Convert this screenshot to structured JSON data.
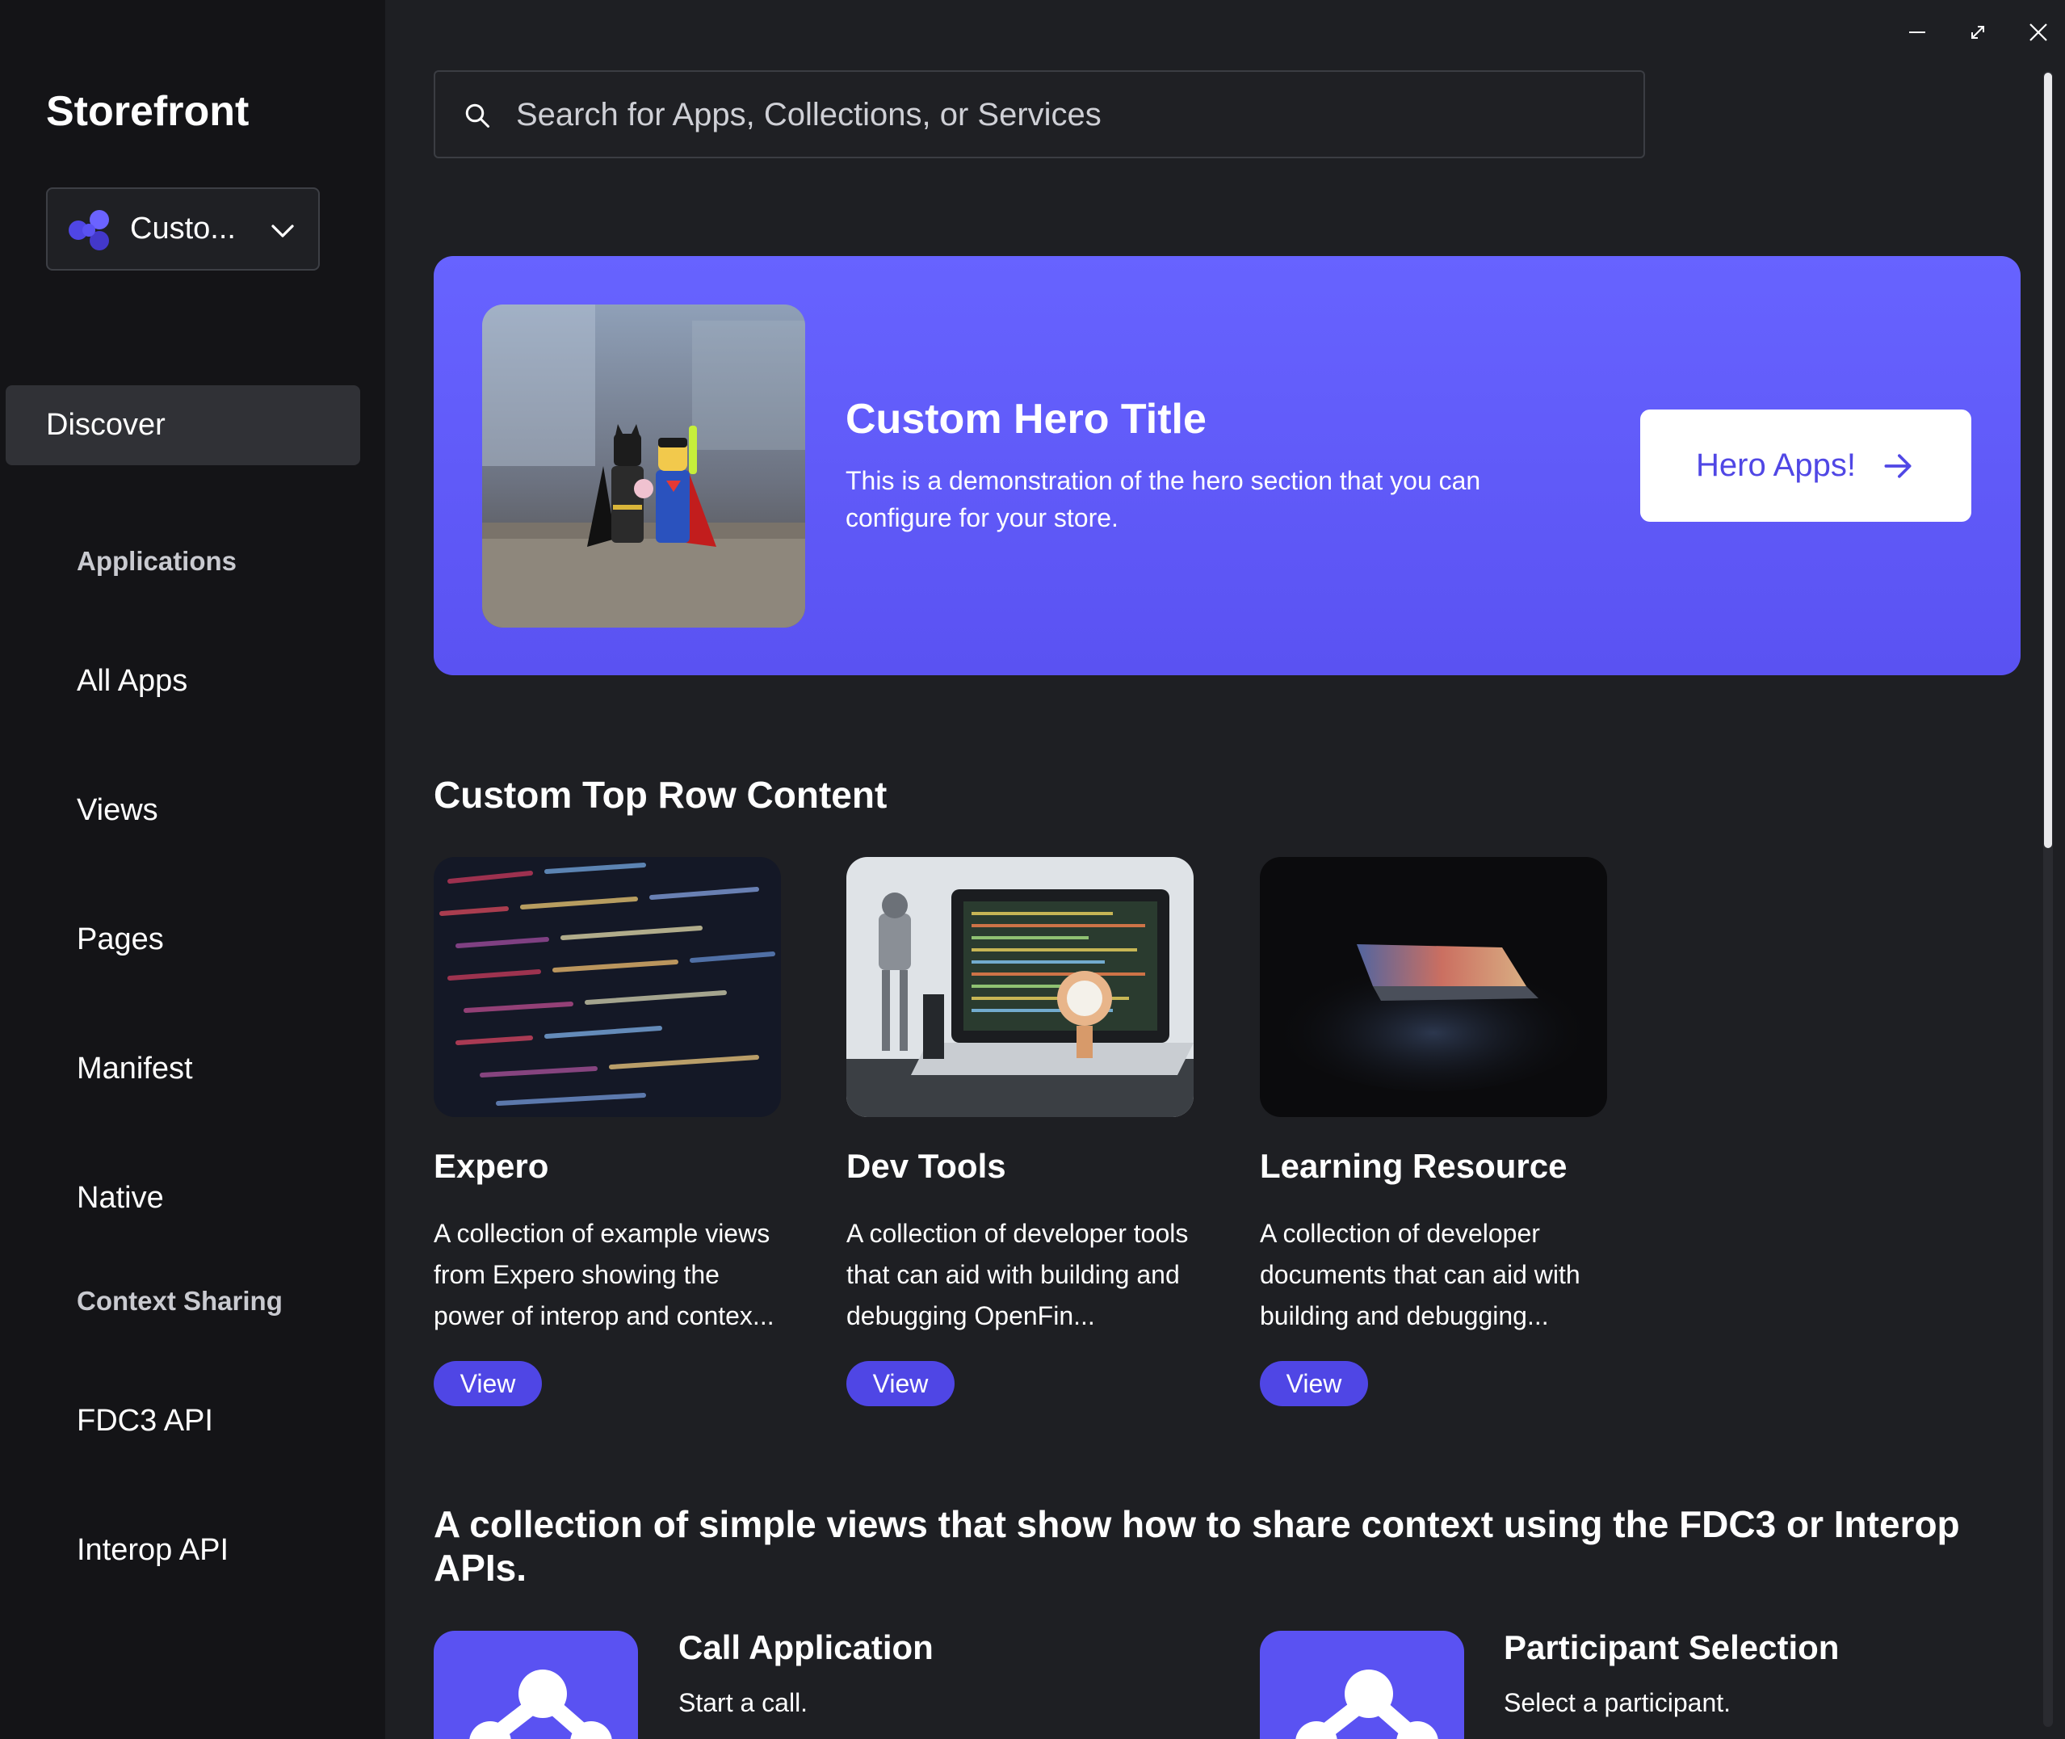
{
  "sidebar": {
    "brand": "Storefront",
    "store_select": {
      "label": "Custo..."
    },
    "discover": "Discover",
    "sections": [
      {
        "title": "Applications",
        "items": [
          "All Apps",
          "Views",
          "Pages",
          "Manifest",
          "Native"
        ]
      },
      {
        "title": "Context Sharing",
        "items": [
          "FDC3 API",
          "Interop API"
        ]
      }
    ]
  },
  "search": {
    "placeholder": "Search for Apps, Collections, or Services"
  },
  "hero": {
    "title": "Custom Hero Title",
    "description": "This is a demonstration of the hero section that you can configure for your store.",
    "button_label": "Hero Apps!"
  },
  "top_row": {
    "title": "Custom Top Row Content",
    "cards": [
      {
        "title": "Expero",
        "description": "A collection of example views from Expero showing the power of interop and contex...",
        "button": "View"
      },
      {
        "title": "Dev Tools",
        "description": "A collection of developer tools that can aid with building and debugging OpenFin...",
        "button": "View"
      },
      {
        "title": "Learning Resource",
        "description": "A collection of developer documents that can aid with building and debugging...",
        "button": "View"
      }
    ]
  },
  "context_section": {
    "title": "A collection of simple views that show how to share context using the FDC3 or Interop APIs.",
    "items": [
      {
        "title": "Call Application",
        "description": "Start a call."
      },
      {
        "title": "Participant Selection",
        "description": "Select a participant."
      }
    ]
  },
  "colors": {
    "accent": "#4f46e5",
    "hero_bg": "#5f5af7",
    "sidebar_bg": "#141417",
    "content_bg": "#1e1f23"
  }
}
